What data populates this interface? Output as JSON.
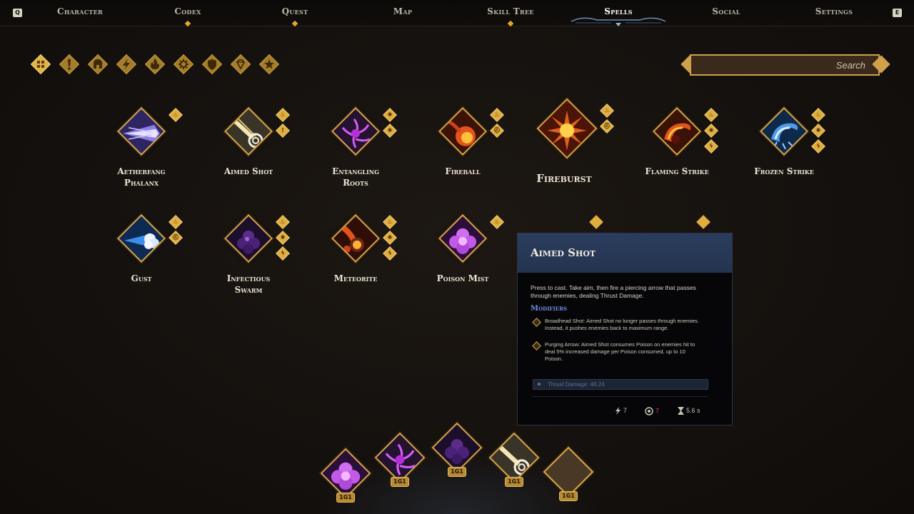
{
  "nav": {
    "left_key": "Q",
    "right_key": "E",
    "tabs": [
      {
        "label": "Character",
        "dot": false
      },
      {
        "label": "Codex",
        "dot": true
      },
      {
        "label": "Quest",
        "dot": true
      },
      {
        "label": "Map",
        "dot": false
      },
      {
        "label": "Skill Tree",
        "dot": true
      },
      {
        "label": "Spells",
        "dot": false,
        "active": true
      },
      {
        "label": "Social",
        "dot": false
      },
      {
        "label": "Settings",
        "dot": false
      }
    ]
  },
  "filters": [
    "all-grid-icon",
    "exclamation-icon",
    "helmet-icon",
    "lightning-icon",
    "flame-icon",
    "sun-gear-icon",
    "shield-icon",
    "gem-icon",
    "star-icon"
  ],
  "search": {
    "placeholder": "Search"
  },
  "spells": [
    {
      "name_line1": "Aetherfang",
      "name_line2": "Phalanx",
      "icon": "aetherfang-phalanx-icon",
      "tags": [
        "flame"
      ]
    },
    {
      "name_line1": "Aimed Shot",
      "name_line2": "",
      "icon": "aimed-shot-icon",
      "tags": [
        "flame",
        "exclamation"
      ]
    },
    {
      "name_line1": "Entangling",
      "name_line2": "Roots",
      "icon": "entangling-roots-icon",
      "tags": [
        "sun",
        "sun"
      ]
    },
    {
      "name_line1": "Fireball",
      "name_line2": "",
      "icon": "fireball-icon",
      "tags": [
        "flame",
        "helmet"
      ]
    },
    {
      "name_line1": "Fireburst",
      "name_line2": "",
      "icon": "fireburst-icon",
      "tags": [
        "flame",
        "helmet"
      ]
    },
    {
      "name_line1": "Flaming Strike",
      "name_line2": "",
      "icon": "flaming-strike-icon",
      "tags": [
        "flame",
        "sun",
        "lightning"
      ]
    },
    {
      "name_line1": "Frozen Strike",
      "name_line2": "",
      "icon": "frozen-strike-icon",
      "tags": [
        "flame",
        "sun",
        "lightning"
      ]
    },
    {
      "name_line1": "Gust",
      "name_line2": "",
      "icon": "gust-icon",
      "tags": [
        "flame",
        "helmet"
      ]
    },
    {
      "name_line1": "Infectious",
      "name_line2": "Swarm",
      "icon": "infectious-swarm-icon",
      "tags": [
        "flame",
        "sun",
        "lightning"
      ]
    },
    {
      "name_line1": "Meteorite",
      "name_line2": "",
      "icon": "meteorite-icon",
      "tags": [
        "flame",
        "sun",
        "lightning"
      ]
    },
    {
      "name_line1": "Poison Mist",
      "name_line2": "",
      "icon": "poison-mist-icon",
      "tags": [
        "flame"
      ]
    }
  ],
  "tooltip": {
    "title": "Aimed Shot",
    "description": "Press to cast. Take aim, then fire a piercing arrow that passes through enemies, dealing Thrust Damage.",
    "modifiers_title": "Modifiers",
    "modifiers": [
      "Broadhead Shot: Aimed Shot no longer passes through enemies. Instead, it pushes enemies back to maximum range.",
      "Purging Arrow: Aimed Shot consumes Poison on enemies hit to deal 5% increased damage per Poison consumed, up to 10 Poison."
    ],
    "stat": "Thrust Damage: 48.24",
    "energy_cost": "7",
    "focus_cost": "7",
    "cooldown": "5.6 s"
  },
  "hotbar": [
    {
      "icon": "poison-mist-icon",
      "key": "1G1"
    },
    {
      "icon": "entangling-roots-icon",
      "key": "1G1"
    },
    {
      "icon": "infectious-swarm-icon",
      "key": "1G1"
    },
    {
      "icon": "aimed-shot-icon",
      "key": "1G1"
    },
    {
      "icon": "empty-slot",
      "key": "1G1"
    }
  ],
  "colors": {
    "gold": "#d7a64a",
    "tooltip_header": "#2b3d5e",
    "modifier_title": "#6f8ee0"
  }
}
